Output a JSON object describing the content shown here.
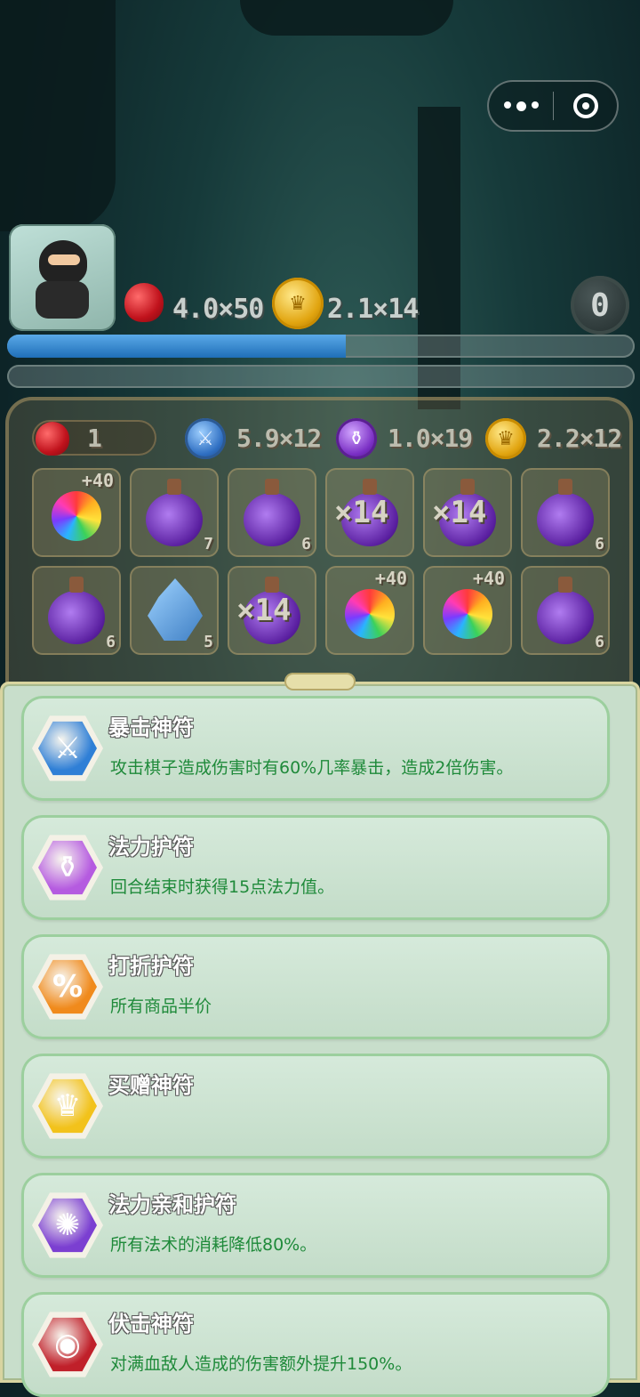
{
  "header": {
    "hp_text": "4.0×50",
    "gold_text": "2.1×14",
    "counter": "0",
    "progress": 0.54
  },
  "board_stats": {
    "hearts": "1",
    "attack": "5.9×12",
    "mana": "1.0×19",
    "gold": "2.2×12"
  },
  "board": {
    "cells": [
      {
        "kind": "swirl",
        "plus": "+40"
      },
      {
        "kind": "potion",
        "count": "7"
      },
      {
        "kind": "potion",
        "count": "6"
      },
      {
        "kind": "potion",
        "mult": "×14"
      },
      {
        "kind": "potion",
        "mult": "×14"
      },
      {
        "kind": "potion",
        "count": "6"
      },
      {
        "kind": "potion",
        "count": "6"
      },
      {
        "kind": "crystal",
        "count": "5"
      },
      {
        "kind": "potion",
        "mult": "×14"
      },
      {
        "kind": "swirl",
        "plus": "+40"
      },
      {
        "kind": "swirl",
        "plus": "+40"
      },
      {
        "kind": "potion",
        "count": "6"
      }
    ]
  },
  "amulets": [
    {
      "title": "暴击神符",
      "desc": "攻击棋子造成伤害时有60%几率暴击，造成2倍伤害。",
      "icon": "crossed-swords-icon",
      "color": "#2f7fd6"
    },
    {
      "title": "法力护符",
      "desc": "回合结束时获得15点法力值。",
      "icon": "mana-potion-icon",
      "color": "#b55be0"
    },
    {
      "title": "打折护符",
      "desc": "所有商品半价",
      "icon": "sales-tag-icon",
      "color": "#f08a1c"
    },
    {
      "title": "买赠神符",
      "desc": "",
      "icon": "gold-crown-coin-icon",
      "color": "#f2c21b"
    },
    {
      "title": "法力亲和护符",
      "desc": "所有法术的消耗降低80%。",
      "icon": "arcane-sigil-icon",
      "color": "#7b3fd1"
    },
    {
      "title": "伏击神符",
      "desc": "对满血敌人造成的伤害额外提升150%。",
      "icon": "ninja-face-icon",
      "color": "#c0202a"
    }
  ]
}
